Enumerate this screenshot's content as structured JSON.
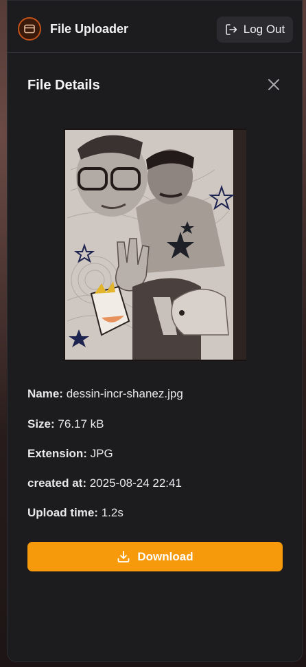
{
  "header": {
    "app_title": "File Uploader",
    "logout_label": "Log Out"
  },
  "panel": {
    "title": "File Details",
    "close_icon": "close-icon"
  },
  "file": {
    "name_label": "Name:",
    "name_value": "dessin-incr-shanez.jpg",
    "size_label": "Size:",
    "size_value": "76.17 kB",
    "extension_label": "Extension:",
    "extension_value": "JPG",
    "created_label": "created at:",
    "created_value": "2025-08-24 22:41",
    "upload_label": "Upload time:",
    "upload_value": "1.2s"
  },
  "actions": {
    "download_label": "Download"
  },
  "colors": {
    "accent": "#f6990a",
    "surface": "#1c1c1f",
    "logo_ring": "#c2531a"
  }
}
